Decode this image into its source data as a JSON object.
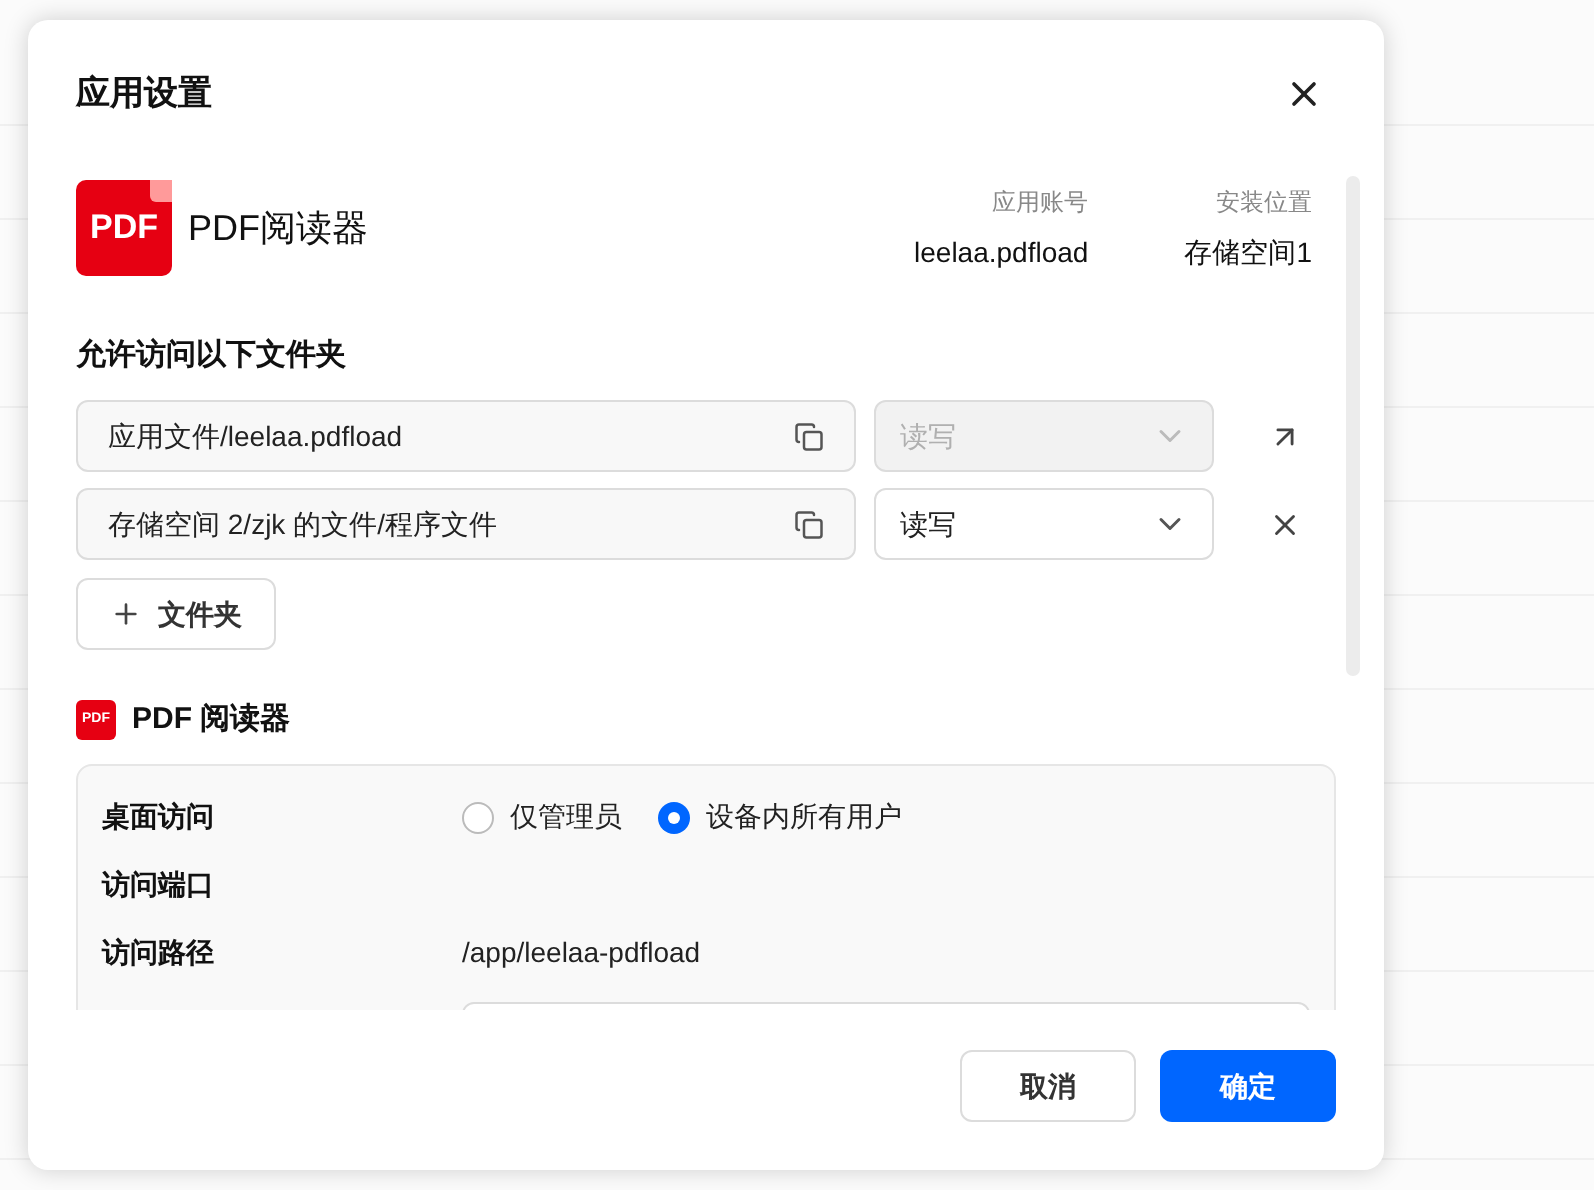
{
  "dialog": {
    "title": "应用设置",
    "app": {
      "icon_text": "PDF",
      "name": "PDF阅读器",
      "meta": [
        {
          "label": "应用账号",
          "value": "leelaa.pdfload"
        },
        {
          "label": "安装位置",
          "value": "存储空间1"
        }
      ]
    },
    "folders": {
      "title": "允许访问以下文件夹",
      "rows": [
        {
          "path": "应用文件/leelaa.pdfload",
          "permission": "读写",
          "disabled": true,
          "kind": "open"
        },
        {
          "path": "存储空间 2/zjk 的文件/程序文件",
          "permission": "读写",
          "disabled": false,
          "kind": "remove"
        }
      ],
      "add_button": "文件夹"
    },
    "section": {
      "icon_text": "PDF",
      "title": "PDF 阅读器",
      "rows": [
        {
          "kind": "radio",
          "label": "桌面访问",
          "options": [
            {
              "label": "仅管理员",
              "selected": false
            },
            {
              "label": "设备内所有用户",
              "selected": true
            }
          ]
        },
        {
          "kind": "empty",
          "label": "访问端口"
        },
        {
          "kind": "text",
          "label": "访问路径",
          "value": "/app/leelaa-pdfload"
        },
        {
          "kind": "input"
        }
      ]
    },
    "buttons": [
      {
        "label": "取消",
        "kind": "secondary"
      },
      {
        "label": "确定",
        "kind": "primary"
      }
    ]
  }
}
